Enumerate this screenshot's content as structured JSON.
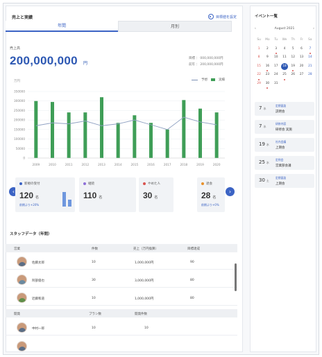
{
  "main": {
    "title": "売上と実績",
    "settings_link": "目標値を設定",
    "tabs": [
      "年間",
      "月別"
    ]
  },
  "kpi": {
    "label": "売上高",
    "value": "200,000,000",
    "unit": "円",
    "target": "目標 ： 000,000,000円",
    "previous": "前年 ： 200,000,000円"
  },
  "chart": {
    "y_unit": "万円",
    "legend_target": "予想",
    "legend_actual": "実績",
    "y_ticks": [
      "0",
      "50000",
      "100000",
      "150000",
      "200000",
      "250000",
      "300000",
      "350000"
    ]
  },
  "chart_data": {
    "type": "bar",
    "categories": [
      "2009",
      "2010",
      "2011",
      "2012",
      "2013",
      "2014",
      "2015",
      "2016",
      "2017",
      "2018",
      "2019",
      "2020"
    ],
    "series": [
      {
        "values": [
          300000,
          295000,
          240000,
          240000,
          320000,
          185000,
          225000,
          185000,
          150000,
          305000,
          260000,
          240000
        ]
      },
      {
        "values": [
          170000,
          185000,
          180000,
          195000,
          170000,
          180000,
          200000,
          175000,
          150000,
          215000,
          190000,
          175000
        ]
      }
    ],
    "xlabel": "",
    "ylabel": "",
    "ylim": [
      0,
      350000
    ]
  },
  "cards": [
    {
      "label": "新規の受付",
      "value": "120",
      "unit": "名",
      "note": "前期より+20%",
      "color": "#3b63c4",
      "minibars": [
        0.75,
        0.35
      ]
    },
    {
      "label": "継続",
      "value": "110",
      "unit": "名",
      "color": "#8e6fd8"
    },
    {
      "label": "やめた人",
      "value": "30",
      "unit": "名",
      "color": "#d9534f"
    },
    {
      "label": "退会",
      "value": "28",
      "unit": "名",
      "note": "前期より+0%",
      "color": "#e8902a"
    }
  ],
  "staff": {
    "title": "スタッフデータ（年間）",
    "group1_headers": [
      "営業",
      "件数",
      "売上（万円換算）",
      "目標達成"
    ],
    "group1_rows": [
      {
        "name": "佐藤太郎",
        "count": "10",
        "sales": "1,000,000円",
        "rate": "90"
      },
      {
        "name": "阿部俊也",
        "count": "30",
        "sales": "3,000,000円",
        "rate": "80"
      },
      {
        "name": "近藤和道",
        "count": "10",
        "sales": "1,000,000円",
        "rate": "80"
      }
    ],
    "group2_headers": [
      "開発",
      "プラン数",
      "開発件数"
    ],
    "group2_rows": [
      {
        "name": "中村一郎",
        "count": "10",
        "sales": "10"
      }
    ]
  },
  "events": {
    "title": "イベント一覧",
    "month": "August 2021",
    "prev": "‹",
    "next": "›",
    "weekdays": [
      "Su",
      "Mo",
      "Tu",
      "We",
      "Th",
      "Fr",
      "Sa"
    ],
    "weeks": [
      [
        "1",
        "2",
        "3",
        "4",
        "5",
        "6",
        "7"
      ],
      [
        "8",
        "9",
        "10",
        "11",
        "12",
        "13",
        "14"
      ],
      [
        "15",
        "16",
        "17",
        "18",
        "19",
        "20",
        "21"
      ],
      [
        "22",
        "23",
        "24",
        "25",
        "26",
        "27",
        "28"
      ],
      [
        "29",
        "30",
        "31",
        "",
        "",
        "",
        ""
      ]
    ],
    "items": [
      {
        "day": "7",
        "dow": "水",
        "tag": "定期面談",
        "name": "説明会"
      },
      {
        "day": "7",
        "dow": "水",
        "tag": "研修内容",
        "name": "研修会 実施"
      },
      {
        "day": "19",
        "dow": "水",
        "tag": "社内会議",
        "name": "上期会"
      },
      {
        "day": "25",
        "dow": "水",
        "tag": "定例会",
        "name": "営業部会議"
      },
      {
        "day": "30",
        "dow": "土",
        "tag": "定期面談",
        "name": "上期会"
      }
    ]
  }
}
